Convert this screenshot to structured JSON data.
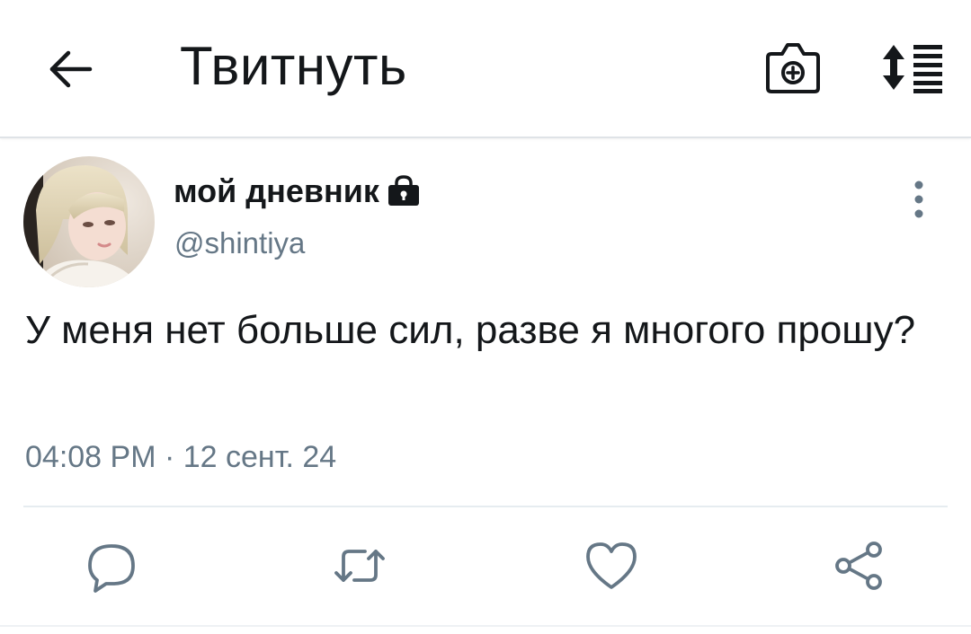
{
  "header": {
    "title": "Твитнуть"
  },
  "tweet": {
    "display_name": "мой дневник",
    "username": "@shintiya",
    "text": "У меня нет больше сил, разве я многого прошу?",
    "timestamp": "04:08 PM · 12 сент. 24"
  },
  "icons": {
    "back": "arrow-left-icon",
    "camera": "camera-add-icon",
    "sort": "sort-list-icon",
    "lock": "lock-icon",
    "more": "more-vertical-icon",
    "reply": "reply-icon",
    "retweet": "retweet-icon",
    "like": "heart-icon",
    "share": "share-icon"
  },
  "colors": {
    "text_primary": "#14171a",
    "text_secondary": "#657786",
    "icon_gray": "#657786",
    "divider": "#e6ecf0"
  }
}
